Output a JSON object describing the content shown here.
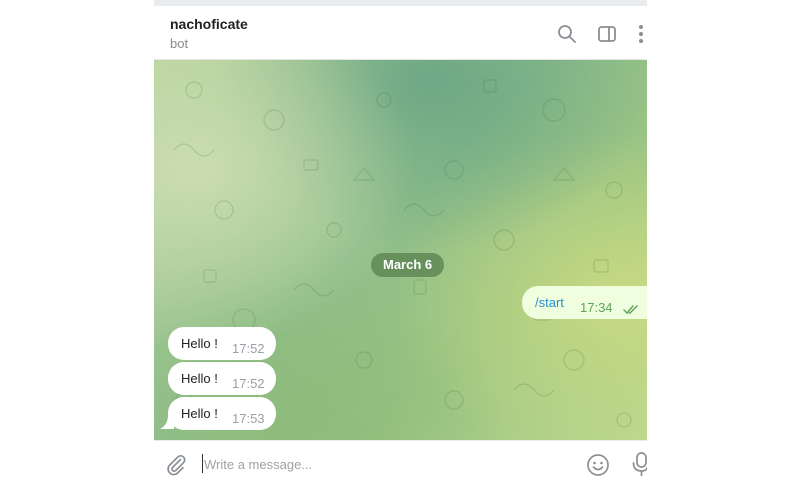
{
  "header": {
    "chat_name": "nachoficate",
    "chat_status": "bot",
    "icons": [
      "search-icon",
      "sidebar-toggle-icon",
      "more-vertical-icon"
    ]
  },
  "chat": {
    "date_separator": "March 6",
    "outgoing": [
      {
        "text": "/start",
        "time": "17:34",
        "status": "read"
      }
    ],
    "incoming": [
      {
        "text": "Hello !",
        "time": "17:52"
      },
      {
        "text": "Hello !",
        "time": "17:52"
      },
      {
        "text": "Hello !",
        "time": "17:53"
      }
    ]
  },
  "composer": {
    "placeholder": "Write a message...",
    "value": "",
    "icons": [
      "paperclip-icon",
      "emoji-icon",
      "microphone-icon"
    ]
  },
  "colors": {
    "outgoing_bubble": "#eefedf",
    "incoming_bubble": "#ffffff",
    "link_text": "#2a8fd0",
    "outgoing_time": "#5ea35a",
    "date_pill": "#5f8755"
  }
}
